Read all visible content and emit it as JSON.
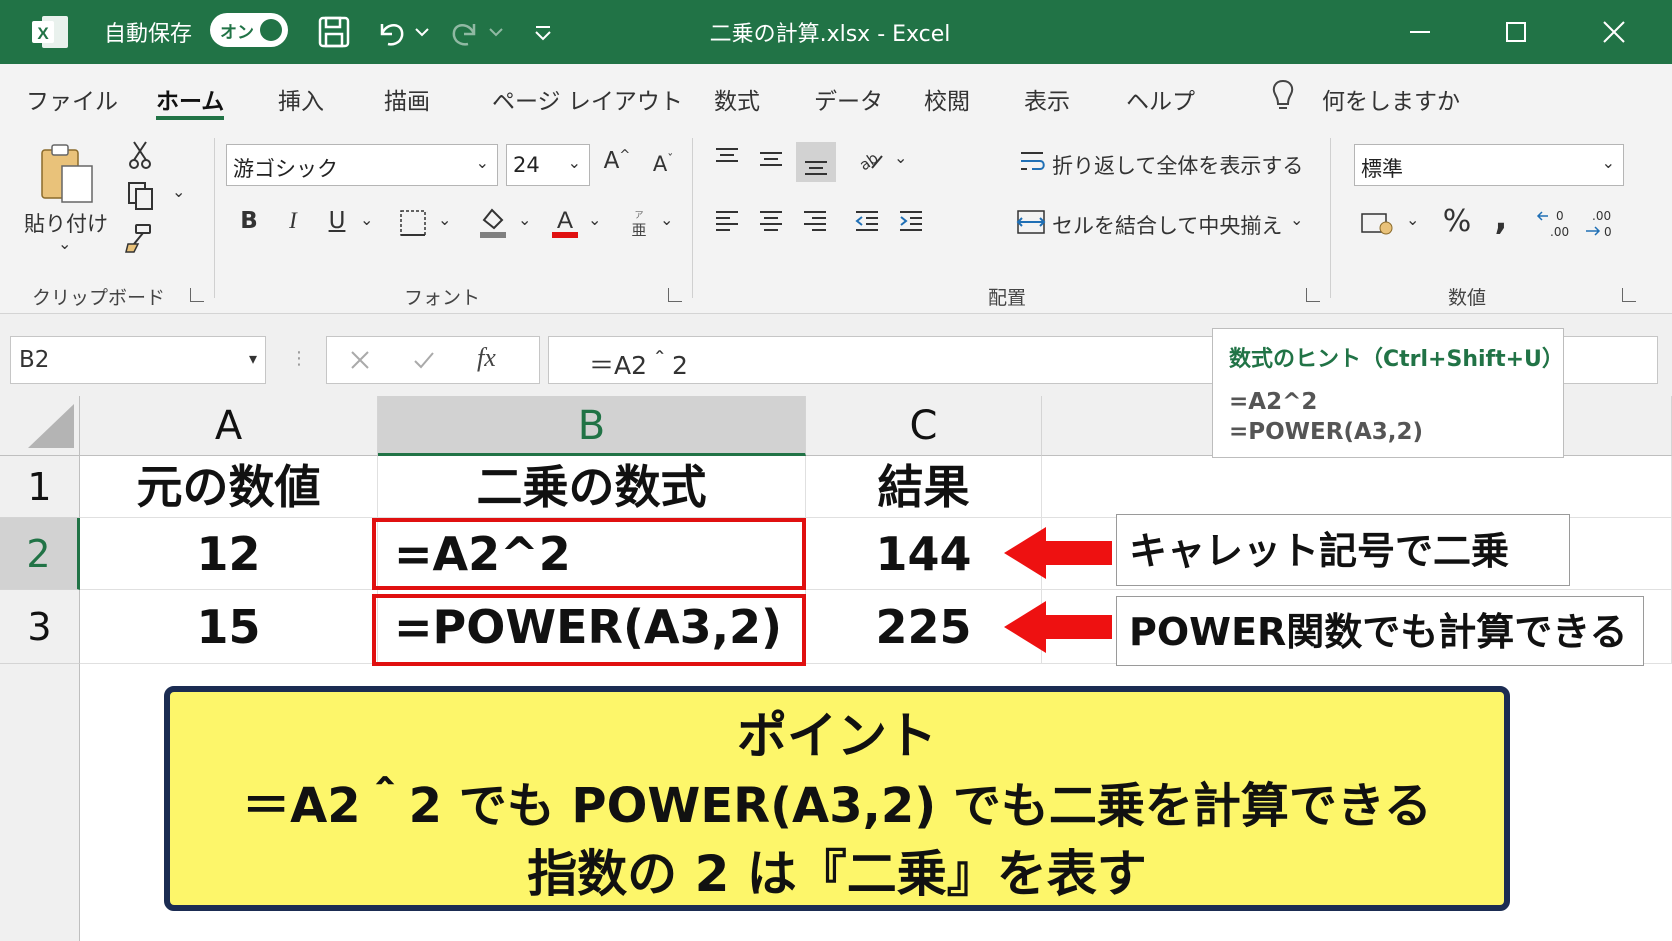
{
  "titlebar": {
    "autosave_label": "自動保存",
    "autosave_toggle": "オン",
    "document_title": "二乗の計算.xlsx  -  Excel"
  },
  "ribbon_tabs": [
    "ファイル",
    "ホーム",
    "挿入",
    "描画",
    "ページ レイアウト",
    "数式",
    "データ",
    "校閲",
    "表示",
    "ヘルプ"
  ],
  "tell_me": "何をしますか",
  "ribbon": {
    "paste_label": "貼り付け",
    "clipboard_group": "クリップボード",
    "font_name": "游ゴシック",
    "font_size": "24",
    "font_group": "フォント",
    "bold": "B",
    "italic": "I",
    "underline": "U",
    "wrap_text": "折り返して全体を表示する",
    "merge_center": "セルを結合して中央揃え",
    "alignment_group": "配置",
    "number_format": "標準",
    "number_group": "数値",
    "percent": "%",
    "comma": ","
  },
  "formula_bar": {
    "name_box": "B2",
    "fx": "fx",
    "formula": "＝A2＾2"
  },
  "formula_hint": {
    "title": "数式のヒント（Ctrl+Shift+U）",
    "lines": [
      "=A2^2",
      "=POWER(A3,2)"
    ]
  },
  "sheet": {
    "columns": [
      "A",
      "B",
      "C"
    ],
    "rows": [
      "1",
      "2",
      "3"
    ],
    "cells": [
      [
        "元の数値",
        "二乗の数式",
        "結果"
      ],
      [
        "12",
        "=A2^2",
        "144"
      ],
      [
        "15",
        "=POWER(A3,2)",
        "225"
      ]
    ]
  },
  "callouts": [
    "キャレット記号で二乗",
    "POWER関数でも計算できる"
  ],
  "point_box": {
    "title": "ポイント",
    "line1": "＝A2＾2 でも POWER(A3,2) でも二乗を計算できる",
    "line2": "指数の 2 は『二乗』を表す"
  },
  "colors": {
    "excel_green": "#217346",
    "highlight_red": "#e01010",
    "point_yellow": "#fdf66a",
    "point_border": "#1b2c52"
  }
}
